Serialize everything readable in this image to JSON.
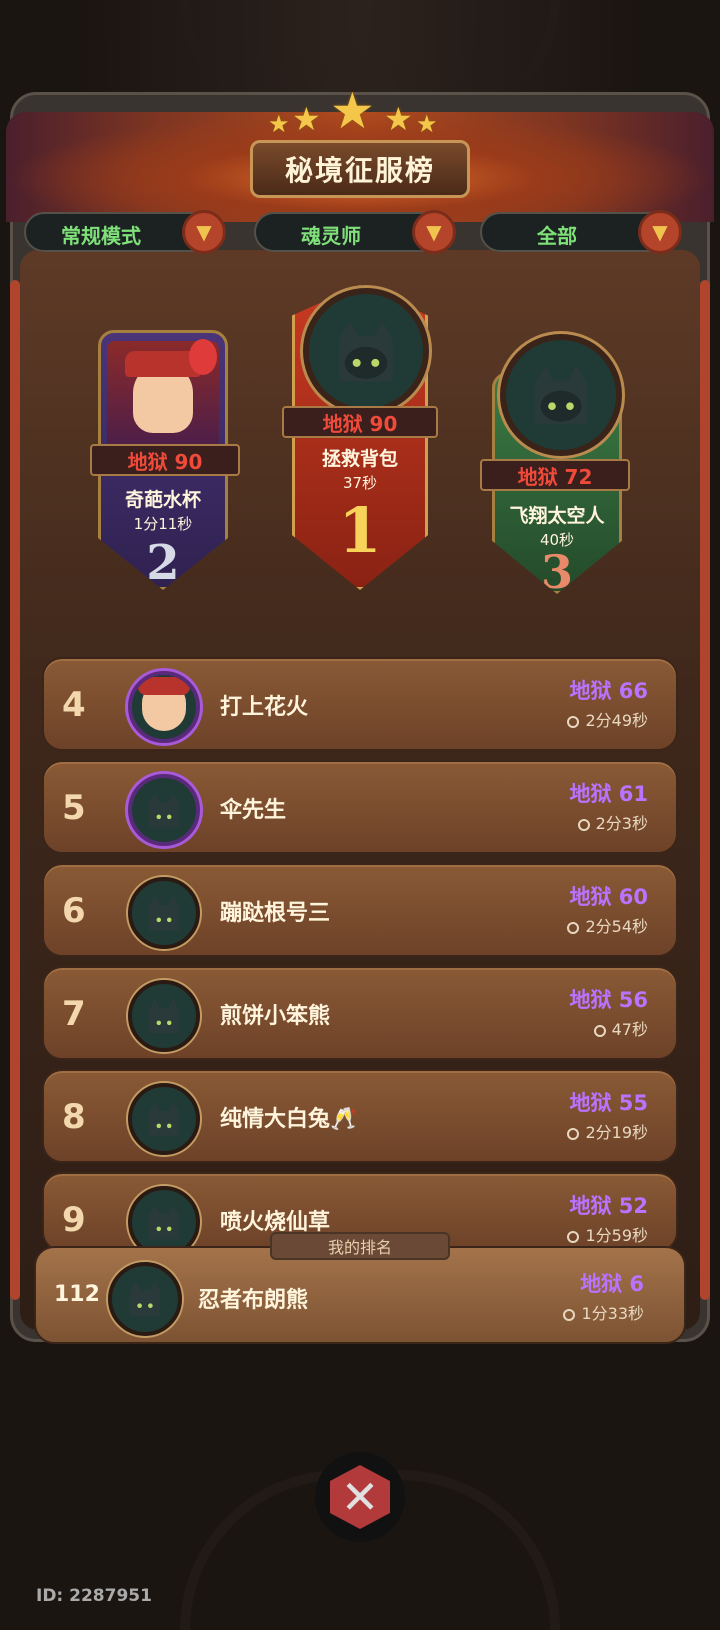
{
  "title": "秘境征服榜",
  "filters": [
    {
      "label": "常规模式"
    },
    {
      "label": "魂灵师"
    },
    {
      "label": "全部"
    }
  ],
  "podium": [
    {
      "rank": "1",
      "level": "地狱 90",
      "name": "拯救背包",
      "time": "37秒",
      "color": "#c23a22"
    },
    {
      "rank": "2",
      "level": "地狱 90",
      "name": "奇葩水杯",
      "time": "1分11秒",
      "color": "#43306e"
    },
    {
      "rank": "3",
      "level": "地狱 72",
      "name": "飞翔太空人",
      "time": "40秒",
      "color": "#2f6a3a"
    }
  ],
  "rows": [
    {
      "rank": "4",
      "name": "打上花火",
      "level": "地狱 66",
      "time": "2分49秒"
    },
    {
      "rank": "5",
      "name": "伞先生",
      "level": "地狱 61",
      "time": "2分3秒"
    },
    {
      "rank": "6",
      "name": "蹦跶根号三",
      "level": "地狱 60",
      "time": "2分54秒"
    },
    {
      "rank": "7",
      "name": "煎饼小笨熊",
      "level": "地狱 56",
      "time": "47秒"
    },
    {
      "rank": "8",
      "name": "纯情大白兔🥂",
      "level": "地狱 55",
      "time": "2分19秒"
    },
    {
      "rank": "9",
      "name": "喷火烧仙草",
      "level": "地狱 52",
      "time": "1分59秒"
    }
  ],
  "my_rank": {
    "tab_label": "我的排名",
    "rank": "112",
    "name": "忍者布朗熊",
    "level": "地狱 6",
    "time": "1分33秒"
  },
  "footer": {
    "id_text": "ID: 2287951"
  },
  "icons": {
    "star": "star-icon",
    "dropdown": "chevron-down-icon",
    "clock": "clock-icon",
    "close": "close-icon"
  }
}
